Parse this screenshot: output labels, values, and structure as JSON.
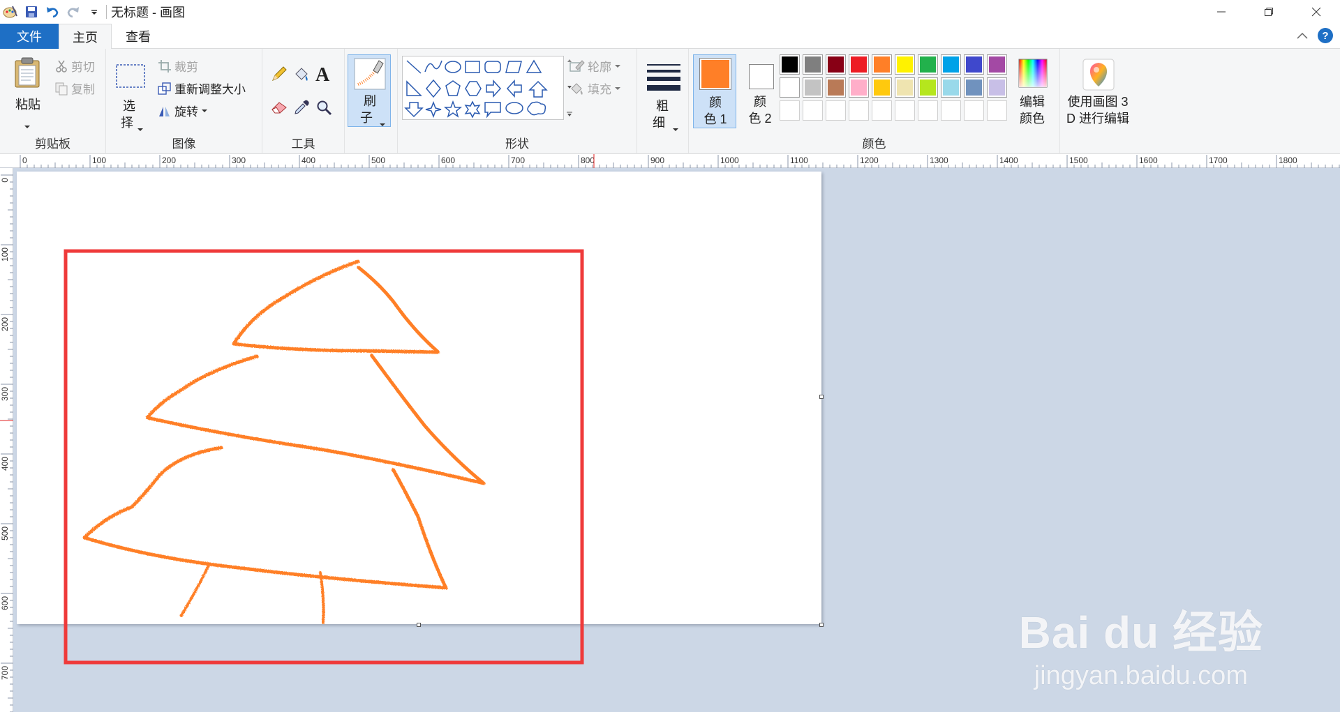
{
  "window": {
    "title": "无标题 - 画图"
  },
  "tabs": {
    "file": "文件",
    "home": "主页",
    "view": "查看"
  },
  "ribbon": {
    "clipboard": {
      "paste_line1": "粘贴",
      "cut": "剪切",
      "copy": "复制",
      "group_label": "剪贴板"
    },
    "image": {
      "select_line1": "选",
      "select_line2": "择",
      "crop": "裁剪",
      "resize": "重新调整大小",
      "rotate": "旋转",
      "group_label": "图像"
    },
    "tools": {
      "text_glyph": "A",
      "group_label": "工具"
    },
    "brushes": {
      "label_line1": "刷",
      "label_line2": "子"
    },
    "shapes": {
      "outline": "轮廓",
      "fill": "填充",
      "group_label": "形状"
    },
    "size": {
      "line1": "粗",
      "line2": "细"
    },
    "colors": {
      "color1_line1": "颜",
      "color1_line2": "色 1",
      "color2_line1": "颜",
      "color2_line2": "色 2",
      "edit_line1": "编辑",
      "edit_line2": "颜色",
      "group_label": "颜色",
      "color1_value": "#ff7f27",
      "color2_value": "#ffffff",
      "palette_row1": [
        "#000000",
        "#7f7f7f",
        "#880015",
        "#ed1c24",
        "#ff7f27",
        "#fff200",
        "#22b14c",
        "#00a2e8",
        "#3f48cc",
        "#a349a4"
      ],
      "palette_row2": [
        "#ffffff",
        "#c3c3c3",
        "#b97a57",
        "#ffaec9",
        "#ffc90e",
        "#efe4b0",
        "#b5e61d",
        "#99d9ea",
        "#7092be",
        "#c8bfe7"
      ]
    },
    "paint3d": {
      "line1": "使用画图 3",
      "line2": "D 进行编辑"
    }
  },
  "ruler": {
    "h_labels": [
      "0",
      "100",
      "200",
      "300",
      "400",
      "500",
      "600",
      "700",
      "800",
      "900",
      "1000",
      "1100",
      "1200",
      "1300",
      "1400",
      "1500",
      "1600",
      "1700",
      "1800"
    ],
    "v_labels": [
      "0",
      "100",
      "200",
      "300",
      "400",
      "500",
      "600",
      "700"
    ]
  },
  "watermark": {
    "main": "Bai du 经验",
    "sub": "jingyan.baidu.com"
  },
  "drawing": {
    "stroke_color": "#ff7f27",
    "highlight_color": "#ef3a3a"
  }
}
